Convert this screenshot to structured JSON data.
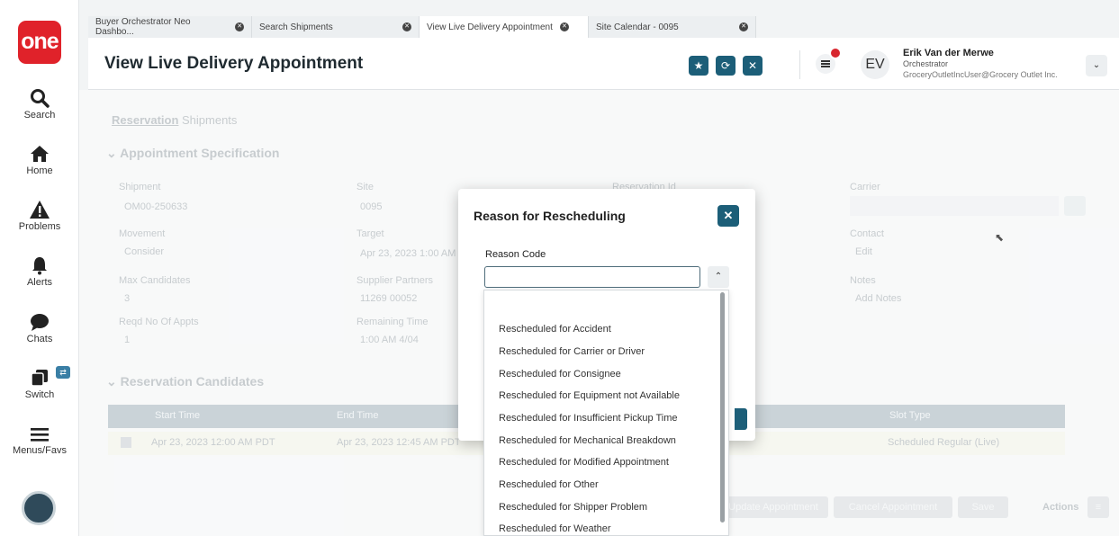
{
  "nav": {
    "logo": "one",
    "items": [
      {
        "label": "Search"
      },
      {
        "label": "Home"
      },
      {
        "label": "Problems"
      },
      {
        "label": "Alerts"
      },
      {
        "label": "Chats"
      },
      {
        "label": "Switch"
      },
      {
        "label": "Menus/Favs"
      }
    ]
  },
  "tabs": [
    {
      "label": "Buyer Orchestrator Neo Dashbo..."
    },
    {
      "label": "Search Shipments"
    },
    {
      "label": "View Live Delivery Appointment"
    },
    {
      "label": "Site Calendar - 0095"
    }
  ],
  "header": {
    "title": "View Live Delivery Appointment",
    "user": {
      "initials": "EV",
      "name": "Erik Van der Merwe",
      "role": "Orchestrator",
      "email": "GroceryOutletIncUser@Grocery Outlet Inc."
    }
  },
  "background": {
    "tabs": [
      "Reservation",
      "Shipments"
    ],
    "section1": "Appointment Specification",
    "fields": [
      {
        "label": "Shipment",
        "value": "OM00-250633"
      },
      {
        "label": "Movement",
        "value": "Consider"
      },
      {
        "label": "Max Candidates",
        "value": "3"
      },
      {
        "label": "Reqd No Of Appts",
        "value": "1"
      },
      {
        "label": "Site",
        "value": "0095"
      },
      {
        "label": "Target",
        "value": "Apr 23, 2023 1:00 AM"
      },
      {
        "label": "Supplier Partners",
        "value": "11269 00052"
      },
      {
        "label": "Remaining Time",
        "value": "1:00 AM 4/04"
      },
      {
        "label": "Reservation Id",
        "value": ""
      },
      {
        "label": "Carrier",
        "value": ""
      },
      {
        "label": "Contact",
        "value": "Edit"
      },
      {
        "label": "Notes",
        "value": "Add Notes"
      }
    ],
    "section2": "Reservation Candidates",
    "grid_headers": [
      "Start Time",
      "End Time",
      "Slot Type"
    ],
    "grid_row": [
      "Apr 23, 2023 12:00 AM PDT",
      "Apr 23, 2023 12:45 AM PDT",
      "Scheduled Regular (Live)"
    ],
    "buttons": [
      "Update Appointment",
      "Cancel Appointment",
      "Save"
    ],
    "actions_label": "Actions"
  },
  "modal": {
    "title": "Reason for Rescheduling",
    "field_label": "Reason Code",
    "input_value": "",
    "input_placeholder": "",
    "options": [
      "Rescheduled for Accident",
      "Rescheduled for Carrier or Driver",
      "Rescheduled for Consignee",
      "Rescheduled for Equipment not Available",
      "Rescheduled for Insufficient Pickup Time",
      "Rescheduled for Mechanical Breakdown",
      "Rescheduled for Modified Appointment",
      "Rescheduled for Other",
      "Rescheduled for Shipper Problem",
      "Rescheduled for Weather"
    ]
  },
  "colors": {
    "brand_red": "#e0222a",
    "accent_teal": "#1c5e78",
    "grid_header": "#9eb0b9"
  }
}
